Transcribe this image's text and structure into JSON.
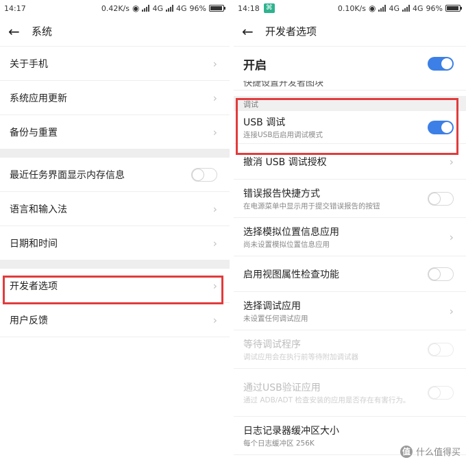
{
  "left": {
    "status": {
      "time": "14:17",
      "speed": "0.42K/s",
      "net1": "4G",
      "net2": "4G",
      "battery": "96%"
    },
    "title": "系统",
    "items": [
      {
        "label": "关于手机"
      },
      {
        "label": "系统应用更新"
      },
      {
        "label": "备份与重置"
      },
      {
        "label": "最近任务界面显示内存信息"
      },
      {
        "label": "语言和输入法"
      },
      {
        "label": "日期和时间"
      },
      {
        "label": "开发者选项"
      },
      {
        "label": "用户反馈"
      }
    ]
  },
  "right": {
    "status": {
      "time": "14:18",
      "speed": "0.10K/s",
      "net1": "4G",
      "net2": "4G",
      "battery": "96%"
    },
    "title": "开发者选项",
    "master_label": "开启",
    "cutoff_label": "快捷设置开发者图块",
    "section_label": "调试",
    "items": [
      {
        "label": "USB 调试",
        "sub": "连接USB后启用调试模式"
      },
      {
        "label": "撤消 USB 调试授权",
        "sub": ""
      },
      {
        "label": "错误报告快捷方式",
        "sub": "在电源菜单中显示用于提交错误报告的按钮"
      },
      {
        "label": "选择模拟位置信息应用",
        "sub": "尚未设置模拟位置信息应用"
      },
      {
        "label": "启用视图属性检查功能",
        "sub": ""
      },
      {
        "label": "选择调试应用",
        "sub": "未设置任何调试应用"
      },
      {
        "label": "等待调试程序",
        "sub": "调试应用会在执行前等待附加调试器"
      },
      {
        "label": "通过USB验证应用",
        "sub": "通过 ADB/ADT 检查安装的应用是否存在有害行为。"
      },
      {
        "label": "日志记录器缓冲区大小",
        "sub": "每个日志缓冲区 256K"
      }
    ]
  },
  "watermark": {
    "icon_glyph": "值",
    "text": "什么值得买"
  },
  "colors": {
    "accent": "#3c7fe6",
    "highlight": "#e23b3b"
  }
}
